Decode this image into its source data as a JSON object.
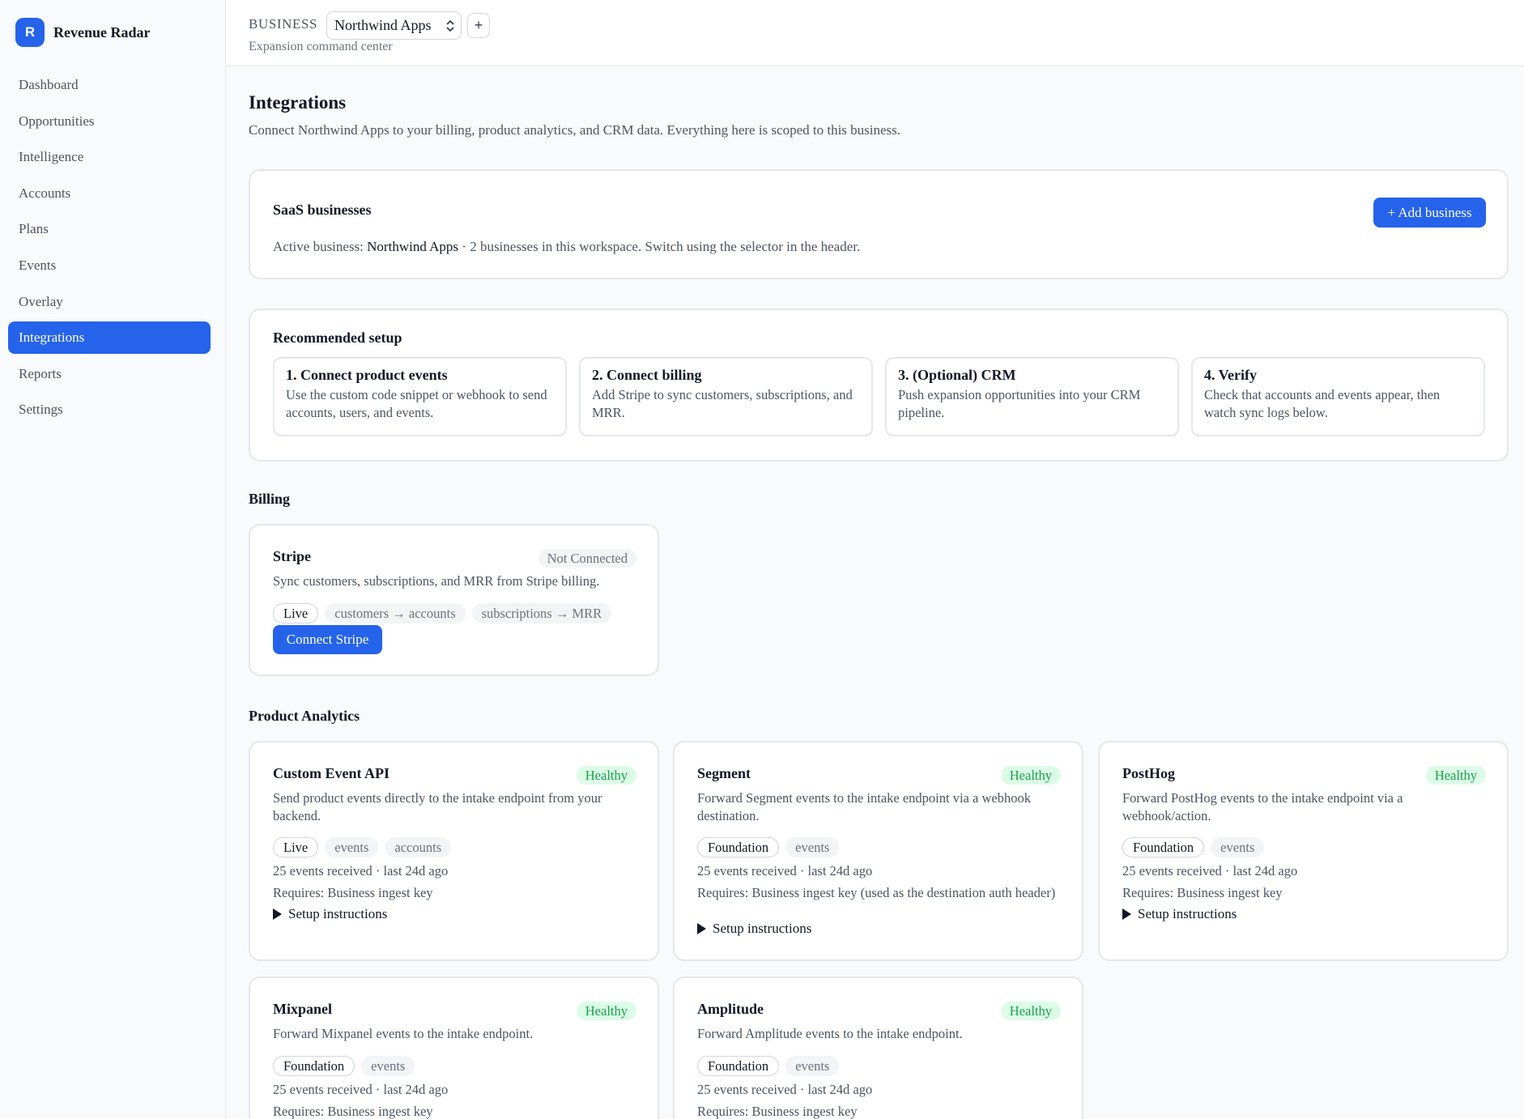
{
  "brand": {
    "logo_letter": "R",
    "name": "Revenue Radar",
    "accent": "#2563eb"
  },
  "sidebar": {
    "items": [
      {
        "label": "Dashboard"
      },
      {
        "label": "Opportunities"
      },
      {
        "label": "Intelligence"
      },
      {
        "label": "Accounts"
      },
      {
        "label": "Plans"
      },
      {
        "label": "Events"
      },
      {
        "label": "Overlay"
      },
      {
        "label": "Integrations",
        "active": true
      },
      {
        "label": "Reports"
      },
      {
        "label": "Settings"
      }
    ]
  },
  "header": {
    "business_label": "BUSINESS",
    "business_selected": "Northwind Apps",
    "add_label": "+",
    "subtitle": "Expansion command center"
  },
  "page": {
    "title": "Integrations",
    "subtitle": "Connect Northwind Apps to your billing, product analytics, and CRM data. Everything here is scoped to this business."
  },
  "saas": {
    "title": "SaaS businesses",
    "add_button": "+ Add business",
    "active_prefix": "Active business: ",
    "active_name": "Northwind Apps",
    "active_suffix": " · 2 businesses in this workspace. Switch using the selector in the header."
  },
  "setup": {
    "title": "Recommended setup",
    "steps": [
      {
        "title": "1. Connect product events",
        "desc": "Use the custom code snippet or webhook to send accounts, users, and events."
      },
      {
        "title": "2. Connect billing",
        "desc": "Add Stripe to sync customers, subscriptions, and MRR."
      },
      {
        "title": "3. (Optional) CRM",
        "desc": "Push expansion opportunities into your CRM pipeline."
      },
      {
        "title": "4. Verify",
        "desc": "Check that accounts and events appear, then watch sync logs below."
      }
    ]
  },
  "billing": {
    "section_title": "Billing",
    "stripe": {
      "name": "Stripe",
      "status": "Not Connected",
      "desc": "Sync customers, subscriptions, and MRR from Stripe billing.",
      "chips": [
        "Live",
        "customers → accounts",
        "subscriptions → MRR"
      ],
      "button": "Connect Stripe"
    }
  },
  "analytics": {
    "section_title": "Product Analytics",
    "setup_label": "Setup instructions",
    "integrations": [
      {
        "name": "Custom Event API",
        "status": "Healthy",
        "desc": "Send product events directly to the intake endpoint from your backend.",
        "chips": [
          "Live",
          "events",
          "accounts"
        ],
        "received": "25 events received · last 24d ago",
        "requires": "Requires: Business ingest key"
      },
      {
        "name": "Segment",
        "status": "Healthy",
        "desc": "Forward Segment events to the intake endpoint via a webhook destination.",
        "chips": [
          "Foundation",
          "events"
        ],
        "received": "25 events received · last 24d ago",
        "requires": "Requires: Business ingest key (used as the destination auth header)"
      },
      {
        "name": "PostHog",
        "status": "Healthy",
        "desc": "Forward PostHog events to the intake endpoint via a webhook/action.",
        "chips": [
          "Foundation",
          "events"
        ],
        "received": "25 events received · last 24d ago",
        "requires": "Requires: Business ingest key"
      },
      {
        "name": "Mixpanel",
        "status": "Healthy",
        "desc": "Forward Mixpanel events to the intake endpoint.",
        "chips": [
          "Foundation",
          "events"
        ],
        "received": "25 events received · last 24d ago",
        "requires": "Requires: Business ingest key"
      },
      {
        "name": "Amplitude",
        "status": "Healthy",
        "desc": "Forward Amplitude events to the intake endpoint.",
        "chips": [
          "Foundation",
          "events"
        ],
        "received": "25 events received · last 24d ago",
        "requires": "Requires: Business ingest key"
      }
    ]
  }
}
